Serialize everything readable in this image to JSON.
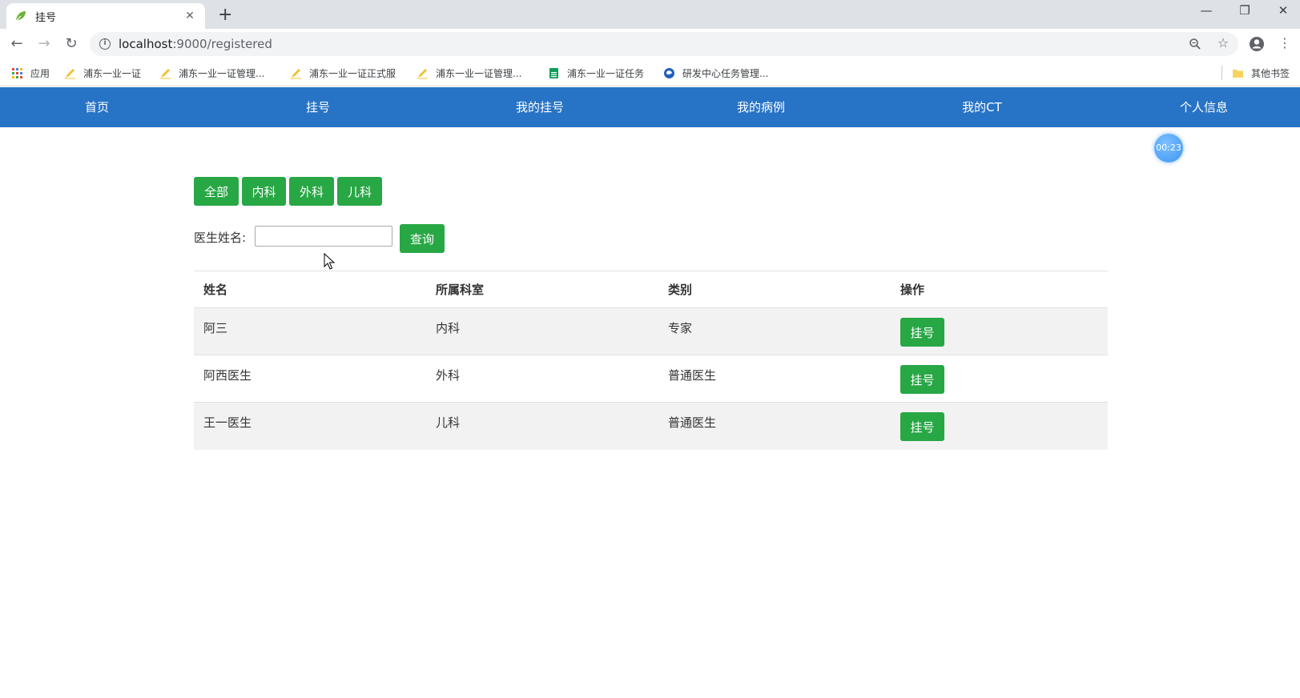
{
  "browser": {
    "tab_title": "挂号",
    "url_host": "localhost",
    "url_path": ":9000/registered",
    "tab_close": "✕",
    "new_tab": "+",
    "minimize": "—",
    "restore": "❐",
    "close": "✕"
  },
  "bookmarks": [
    {
      "label": "应用",
      "icon": "apps-grid-icon"
    },
    {
      "label": "浦东一业一证",
      "icon": "pen-icon"
    },
    {
      "label": "浦东一业一证管理...",
      "icon": "pen-icon"
    },
    {
      "label": "浦东一业一证正式服",
      "icon": "pen-icon"
    },
    {
      "label": "浦东一业一证管理...",
      "icon": "pen-icon"
    },
    {
      "label": "浦东一业一证任务",
      "icon": "sheet-icon"
    },
    {
      "label": "研发中心任务管理...",
      "icon": "globe-icon"
    },
    {
      "label": "其他书签",
      "icon": "folder-icon"
    }
  ],
  "nav": {
    "items": [
      "首页",
      "挂号",
      "我的挂号",
      "我的病例",
      "我的CT",
      "个人信息"
    ],
    "color": "#2773c6"
  },
  "timer": "00:23",
  "filters": [
    "全部",
    "内科",
    "外科",
    "儿科"
  ],
  "search": {
    "label": "医生姓名:",
    "value": "",
    "button": "查询"
  },
  "table": {
    "headers": [
      "姓名",
      "所属科室",
      "类别",
      "操作"
    ],
    "rows": [
      {
        "name": "阿三",
        "dept": "内科",
        "type": "专家",
        "action": "挂号"
      },
      {
        "name": "阿西医生",
        "dept": "外科",
        "type": "普通医生",
        "action": "挂号"
      },
      {
        "name": "王一医生",
        "dept": "儿科",
        "type": "普通医生",
        "action": "挂号"
      }
    ]
  },
  "accent_green": "#28a745"
}
